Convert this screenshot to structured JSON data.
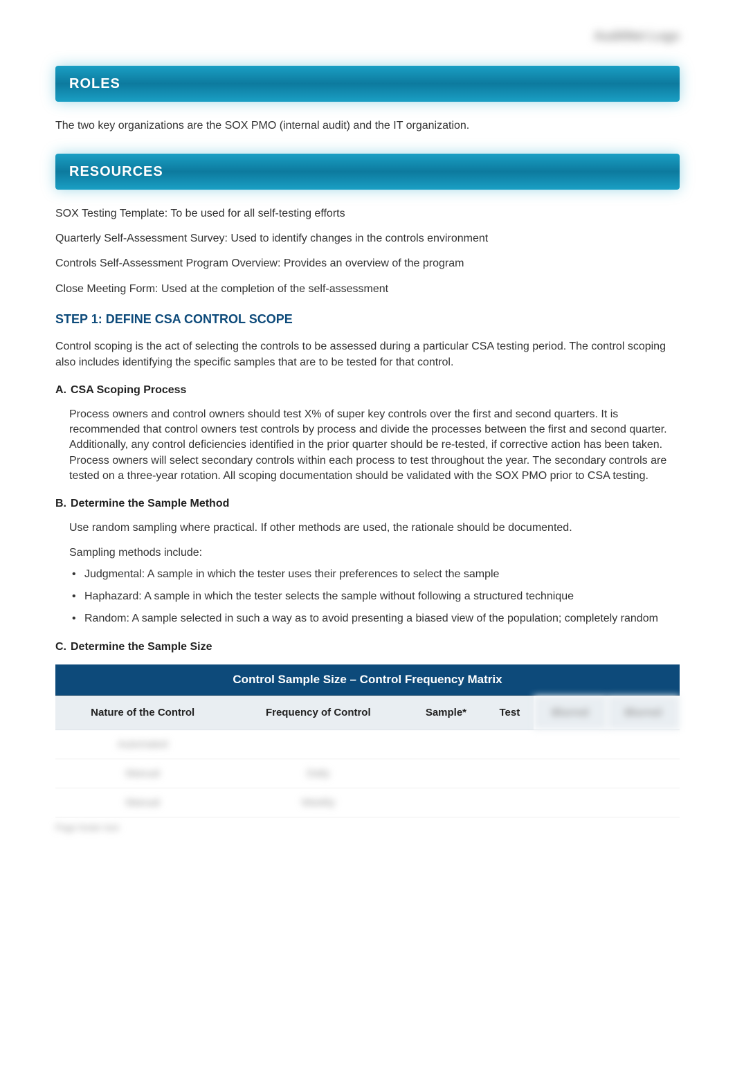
{
  "header": {
    "logo_placeholder": "AuditNet Logo"
  },
  "roles": {
    "banner": "ROLES",
    "text": "The two key organizations are the SOX PMO (internal audit) and the IT organization."
  },
  "resources": {
    "banner": "RESOURCES",
    "items": [
      "SOX Testing Template: To be used for all self-testing efforts",
      "Quarterly Self-Assessment Survey: Used to identify changes in the controls environment",
      "Controls Self-Assessment Program Overview: Provides an overview of the program",
      "Close Meeting Form: Used at the completion of the self-assessment"
    ]
  },
  "step1": {
    "heading": "STEP 1: DEFINE CSA CONTROL SCOPE",
    "intro": "Control scoping is the act of selecting the controls to be assessed during a particular CSA testing period. The control scoping also includes identifying the specific samples that are to be tested for that control.",
    "a": {
      "letter": "A.",
      "title": "CSA Scoping Process",
      "body": "Process owners and control owners should test X% of super key controls over the first and second quarters. It is recommended that control owners test controls by process and divide the processes between the first and second quarter. Additionally, any control deficiencies identified in the prior quarter should be re-tested, if corrective action has been taken. Process owners will select secondary controls within each process to test throughout the year. The secondary controls are tested on a three-year rotation. All scoping documentation should be validated with the SOX PMO prior to CSA testing."
    },
    "b": {
      "letter": "B.",
      "title": "Determine the Sample Method",
      "intro": "Use random sampling where practical. If other methods are used, the rationale should be documented.",
      "methods_label": "Sampling methods include:",
      "methods": [
        "Judgmental: A sample in which the tester uses their preferences to select the sample",
        "Haphazard: A sample in which the tester selects the sample without following a structured technique",
        "Random: A sample selected in such a way as to avoid presenting a biased view of the population; completely random"
      ]
    },
    "c": {
      "letter": "C.",
      "title": "Determine the Sample Size"
    }
  },
  "matrix": {
    "title": "Control Sample Size – Control Frequency Matrix",
    "headers": {
      "col1": "Nature of the Control",
      "col2": "Frequency of Control",
      "col3": "Sample*",
      "col4": "Test",
      "col5": "Blurred",
      "col6": "Blurred"
    },
    "rows": [
      {
        "c1": "Automated",
        "c2": "",
        "c3": "",
        "c4": "",
        "c5": "",
        "c6": ""
      },
      {
        "c1": "Manual",
        "c2": "Daily",
        "c3": "",
        "c4": "",
        "c5": "",
        "c6": ""
      },
      {
        "c1": "Manual",
        "c2": "Weekly",
        "c3": "",
        "c4": "",
        "c5": "",
        "c6": ""
      }
    ]
  },
  "footer": {
    "blurred": "Page footer text"
  }
}
